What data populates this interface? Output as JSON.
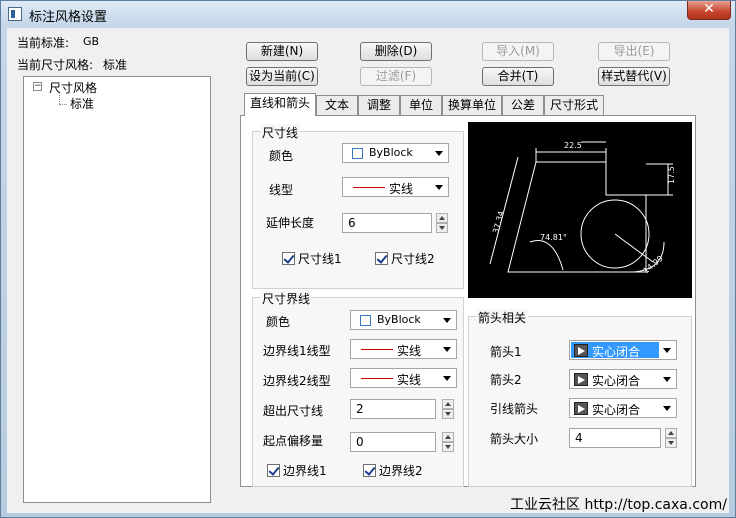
{
  "window": {
    "title": "标注风格设置",
    "close_glyph": "✕"
  },
  "info": {
    "standard_label": "当前标准:",
    "standard_value": "GB",
    "style_label": "当前尺寸风格:",
    "style_value": "标准"
  },
  "tree": {
    "expander": "−",
    "root_label": "尺寸风格",
    "child_label": "标准"
  },
  "buttons": {
    "new": "新建(N)",
    "delete": "删除(D)",
    "import": "导入(M)",
    "export": "导出(E)",
    "set_current": "设为当前(C)",
    "filter": "过滤(F)",
    "merge": "合并(T)",
    "replace": "样式替代(V)"
  },
  "tabs": [
    "直线和箭头",
    "文本",
    "调整",
    "单位",
    "换算单位",
    "公差",
    "尺寸形式"
  ],
  "dim_line": {
    "title": "尺寸线",
    "color_label": "颜色",
    "color_value": "ByBlock",
    "linetype_label": "线型",
    "linetype_value": "实线",
    "extend_label": "延伸长度",
    "extend_value": "6",
    "check1": "尺寸线1",
    "check2": "尺寸线2"
  },
  "ext_line": {
    "title": "尺寸界线",
    "color_label": "颜色",
    "color_value": "ByBlock",
    "linetype1_label": "边界线1线型",
    "linetype1_value": "实线",
    "linetype2_label": "边界线2线型",
    "linetype2_value": "实线",
    "beyond_label": "超出尺寸线",
    "beyond_value": "2",
    "offset_label": "起点偏移量",
    "offset_value": "0",
    "check1": "边界线1",
    "check2": "边界线2"
  },
  "arrow": {
    "title": "箭头相关",
    "arrow1_label": "箭头1",
    "arrow1_value": "实心闭合",
    "arrow2_label": "箭头2",
    "arrow2_value": "实心闭合",
    "leader_label": "引线箭头",
    "leader_value": "实心闭合",
    "size_label": "箭头大小",
    "size_value": "4"
  },
  "preview": {
    "dim_top": "22.5",
    "dim_right": "17.5",
    "dim_left": "37.34",
    "angle": "74.81°",
    "diameter": "14.99"
  },
  "watermark": "工业云社区 http://top.caxa.com/",
  "colors": {
    "selection": "#3399ff",
    "linetype_red": "#d00000",
    "swatch_blue": "#3b76c2"
  }
}
